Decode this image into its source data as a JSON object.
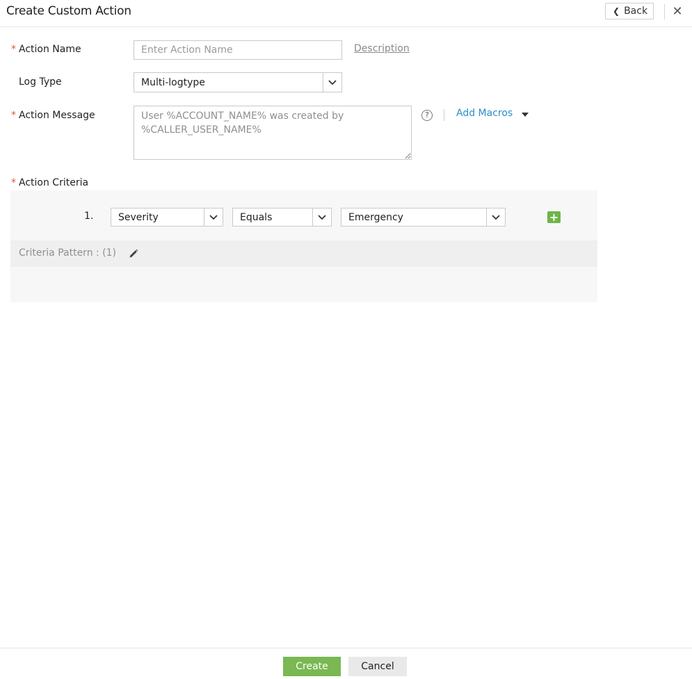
{
  "header": {
    "title": "Create Custom Action",
    "back_label": "Back",
    "close_glyph": "✕"
  },
  "form": {
    "required_marker": "*",
    "action_name": {
      "label": "Action Name",
      "value": "",
      "placeholder": "Enter Action Name",
      "description_link": "Description"
    },
    "log_type": {
      "label": "Log Type",
      "selected": "Multi-logtype"
    },
    "action_message": {
      "label": "Action Message",
      "value": "User %ACCOUNT_NAME% was created by %CALLER_USER_NAME%",
      "help_glyph": "?",
      "add_macros": "Add Macros"
    },
    "action_criteria": {
      "label": "Action Criteria",
      "rows": [
        {
          "number": "1.",
          "field": "Severity",
          "operator": "Equals",
          "value": "Emergency"
        }
      ],
      "add_glyph": "+",
      "pattern_text": "Criteria Pattern : (1)"
    }
  },
  "footer": {
    "create_label": "Create",
    "cancel_label": "Cancel"
  },
  "colors": {
    "accent_link": "#2a8fc7",
    "required": "#e0572a",
    "primary_button": "#7ab853",
    "add_button": "#6db548"
  },
  "icons": {
    "back": "chevron-left-icon",
    "close": "close-icon",
    "help": "question-circle-icon",
    "dropdown": "chevron-down-icon",
    "macros": "caret-down-icon",
    "add": "plus-square-icon",
    "edit": "pencil-icon"
  }
}
